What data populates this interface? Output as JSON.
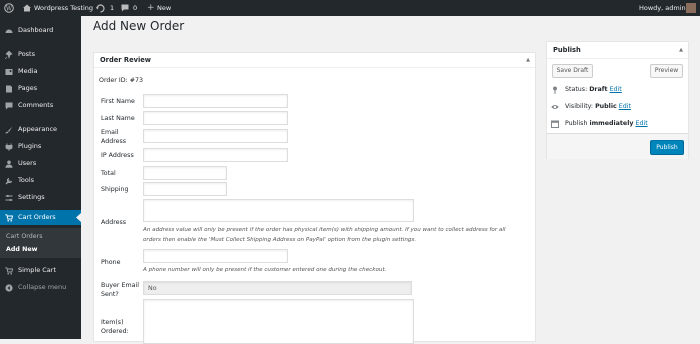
{
  "admin_bar": {
    "site_name": "Wordpress Testing",
    "updates_count": "1",
    "comments_count": "0",
    "new_label": "New",
    "greeting": "Howdy, admin"
  },
  "sidebar": {
    "items": [
      {
        "label": "Dashboard",
        "icon": "dashboard-icon"
      },
      {
        "label": "Posts",
        "icon": "pushpin-icon"
      },
      {
        "label": "Media",
        "icon": "media-icon"
      },
      {
        "label": "Pages",
        "icon": "page-icon"
      },
      {
        "label": "Comments",
        "icon": "comment-icon"
      },
      {
        "label": "Appearance",
        "icon": "paintbrush-icon"
      },
      {
        "label": "Plugins",
        "icon": "plugin-icon"
      },
      {
        "label": "Users",
        "icon": "users-icon"
      },
      {
        "label": "Tools",
        "icon": "wrench-icon"
      },
      {
        "label": "Settings",
        "icon": "settings-icon"
      },
      {
        "label": "Cart Orders",
        "icon": "cart-icon"
      },
      {
        "label": "Simple Cart",
        "icon": "cart-icon"
      },
      {
        "label": "Collapse menu",
        "icon": "collapse-icon"
      }
    ],
    "submenu": [
      {
        "label": "Cart Orders"
      },
      {
        "label": "Add New"
      }
    ]
  },
  "page": {
    "title": "Add New Order"
  },
  "order_review": {
    "heading": "Order Review",
    "order_id": "Order ID: #73",
    "fields": {
      "first_name": {
        "label": "First Name",
        "value": ""
      },
      "last_name": {
        "label": "Last Name",
        "value": ""
      },
      "email_1": "Email",
      "email_2": "Address",
      "ip_address": {
        "label": "IP Address",
        "value": ""
      },
      "total": {
        "label": "Total",
        "value": ""
      },
      "shipping": {
        "label": "Shipping",
        "value": ""
      },
      "address": {
        "label": "Address",
        "value": ""
      },
      "phone": {
        "label": "Phone",
        "value": ""
      },
      "buyer_email_1": "Buyer Email",
      "buyer_email_2": "Sent?",
      "buyer_email_value": "No",
      "items_1": "Item(s)",
      "items_2": "Ordered:"
    },
    "address_hint_1": "An address value will only be present if the order has physical item(s) with shipping amount. If you want to collect address for all",
    "address_hint_2": "orders then enable the 'Must Collect Shipping Address on PayPal' option from the plugin settings.",
    "phone_hint": "A phone number will only be present if the customer entered one during the checkout."
  },
  "publish": {
    "heading": "Publish",
    "save_draft": "Save Draft",
    "preview": "Preview",
    "status_label": "Status: ",
    "status_value": "Draft",
    "visibility_label": "Visibility: ",
    "visibility_value": "Public",
    "publish_label": "Publish ",
    "publish_value": "immediately",
    "edit": "Edit",
    "publish_button": "Publish"
  },
  "colors": {
    "accent": "#0073aa",
    "sidebar_bg": "#23282d",
    "button_primary": "#0085ba"
  }
}
